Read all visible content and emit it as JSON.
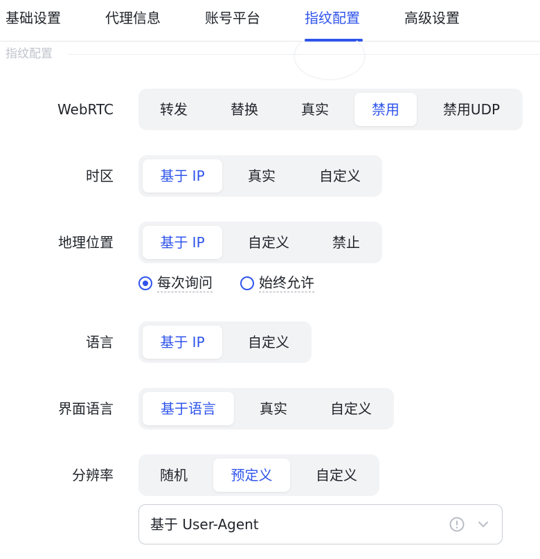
{
  "tabs": [
    {
      "label": "基础设置"
    },
    {
      "label": "代理信息"
    },
    {
      "label": "账号平台"
    },
    {
      "label": "指纹配置",
      "active": true
    },
    {
      "label": "高级设置"
    }
  ],
  "section": {
    "title": "指纹配置"
  },
  "webrtc": {
    "label": "WebRTC",
    "options": [
      "转发",
      "替换",
      "真实",
      "禁用",
      "禁用UDP"
    ],
    "selected": "禁用"
  },
  "timezone": {
    "label": "时区",
    "options": [
      "基于 IP",
      "真实",
      "自定义"
    ],
    "selected": "基于 IP"
  },
  "geo": {
    "label": "地理位置",
    "options": [
      "基于 IP",
      "自定义",
      "禁止"
    ],
    "selected": "基于 IP",
    "permission": {
      "options": [
        "每次询问",
        "始终允许"
      ],
      "selected": "每次询问"
    }
  },
  "language": {
    "label": "语言",
    "options": [
      "基于 IP",
      "自定义"
    ],
    "selected": "基于 IP"
  },
  "ui_language": {
    "label": "界面语言",
    "options": [
      "基于语言",
      "真实",
      "自定义"
    ],
    "selected": "基于语言"
  },
  "resolution": {
    "label": "分辨率",
    "options": [
      "随机",
      "预定义",
      "自定义"
    ],
    "selected": "预定义",
    "select_value": "基于 User-Agent"
  },
  "icons": {
    "info": "info-circle-icon",
    "chevron": "chevron-down-icon"
  },
  "colors": {
    "accent": "#2f54eb",
    "segment_bg": "#f2f3f5",
    "text": "#1f2329",
    "muted": "#c0c4cc"
  }
}
